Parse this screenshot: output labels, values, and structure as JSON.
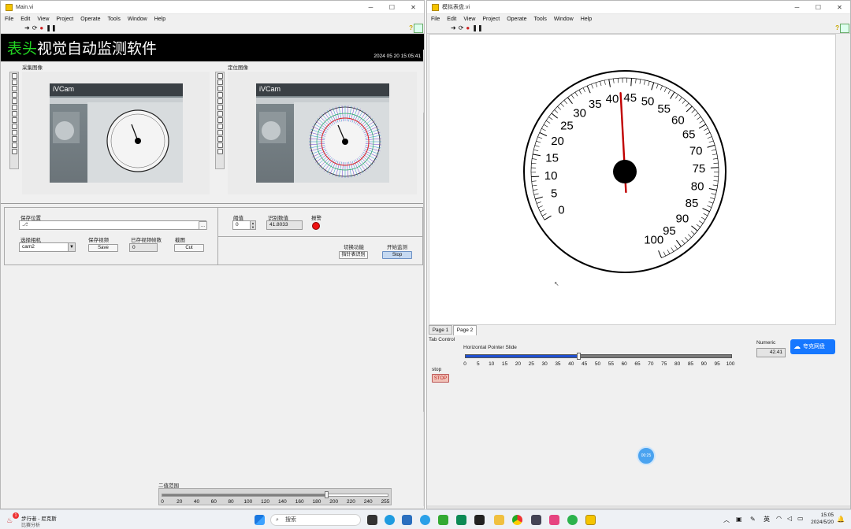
{
  "left": {
    "title": "Main.vi",
    "menu": [
      "File",
      "Edit",
      "View",
      "Project",
      "Operate",
      "Tools",
      "Window",
      "Help"
    ],
    "banner": {
      "green": "表头",
      "white": "视觉自动监测软件",
      "datetime": "2024 05 20 15:05:41"
    },
    "capture_label": "采集图像",
    "locate_label": "定位图像",
    "save_location_label": "保存位置",
    "select_camera_label": "选择相机",
    "camera_value": "cam2",
    "save_video_label": "保存视频",
    "save_button": "Save",
    "saved_frames_label": "已存视频帧数",
    "saved_frames_value": "0",
    "screenshot_label": "截图",
    "cut_button": "Cut",
    "threshold_label": "阈值",
    "threshold_value": "0",
    "reading_label": "识别数值",
    "reading_value": "41.8033",
    "alarm_label": "报警",
    "switch_label": "切换功能",
    "switch_button": "指针表识别",
    "start_label": "开始监测",
    "stop_button": "Stop",
    "browse_button": "...",
    "binary_label": "二值范围",
    "binary_ticks": [
      "0",
      "20",
      "40",
      "60",
      "80",
      "100",
      "120",
      "140",
      "160",
      "180",
      "200",
      "220",
      "240",
      "255"
    ],
    "binary_value": 0.73,
    "webcam_brand": "iVCam"
  },
  "right": {
    "title": "模拟表盘.vi",
    "menu": [
      "File",
      "Edit",
      "View",
      "Project",
      "Operate",
      "Tools",
      "Window",
      "Help"
    ],
    "gauge_labels": [
      "0",
      "5",
      "10",
      "15",
      "20",
      "25",
      "30",
      "35",
      "40",
      "45",
      "50",
      "55",
      "60",
      "65",
      "70",
      "75",
      "80",
      "85",
      "90",
      "95",
      "100"
    ],
    "gauge_value": 42.41,
    "tabs": [
      "Page 1",
      "Page 2"
    ],
    "tab_control_label": "Tab Control",
    "slide_label": "Horizontal Pointer Slide",
    "slide_ticks": [
      "0",
      "5",
      "10",
      "15",
      "20",
      "25",
      "30",
      "35",
      "40",
      "45",
      "50",
      "55",
      "60",
      "65",
      "70",
      "75",
      "80",
      "85",
      "90",
      "95",
      "100"
    ],
    "slide_value": 42.41,
    "numeric_label": "Numeric",
    "numeric_value": "42.41",
    "stop_label": "stop",
    "stop_button": "STOP",
    "cloud_button": "夸克网盘",
    "floating_badge": "00:25"
  },
  "taskbar": {
    "notif_title": "步行者 - 尼克斯",
    "notif_sub": "比赛分析",
    "notif_badge": "1",
    "search_placeholder": "搜索",
    "ime": "英",
    "time": "15:05",
    "date": "2024/5/20"
  },
  "colors": {
    "banner_green": "#22d322",
    "needle": "#c00000",
    "slide_fill": "#1f4fd1",
    "accent": "#1677ff"
  }
}
